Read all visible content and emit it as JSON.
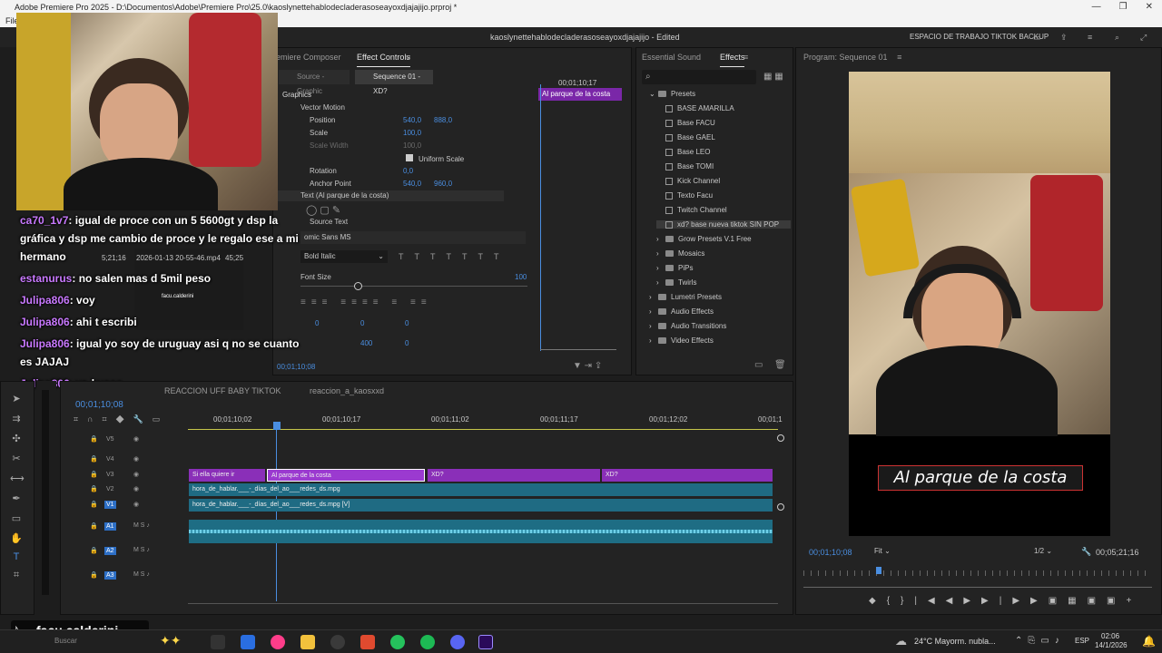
{
  "window": {
    "title": "Adobe Premiere Pro 2025 - D:\\Documentos\\Adobe\\Premiere Pro\\25.0\\kaoslynettehablodecladerasoseayoxdjajajijo.prproj *",
    "menu_first": "File"
  },
  "header": {
    "project_name": "kaoslynettehablodecladerasoseayoxdjajajijo - Edited",
    "workspace": "ESPACIO DE TRABAJO TIKTOK BACKUP"
  },
  "effect_controls": {
    "tab_composer": "remiere Composer",
    "tab_label": "Effect Controls",
    "source_label": "Source - Graphic",
    "sequence_label": "Sequence 01 - XD?",
    "timecode_top": "00;01;10;17",
    "clip_bar_label": "Al parque de la costa",
    "section_graphics": "Graphics",
    "vector_motion": "Vector Motion",
    "position_label": "Position",
    "position_x": "540,0",
    "position_y": "888,0",
    "scale_label": "Scale",
    "scale_value": "100,0",
    "scale_width_label": "Scale Width",
    "scale_width_value": "100,0",
    "uniform_scale": "Uniform Scale",
    "rotation_label": "Rotation",
    "rotation_value": "0,0",
    "anchor_label": "Anchor Point",
    "anchor_x": "540,0",
    "anchor_y": "960,0",
    "text_layer": "Text (Al parque de la costa)",
    "source_text": "Source Text",
    "font_name": "omic Sans MS",
    "font_style": "Bold Italic",
    "font_size_label": "Font Size",
    "font_size_value": "100",
    "kerning_value": "0",
    "tracking_value": "0",
    "leading_value": "0",
    "baseline_value": "0",
    "tsume_value": "400",
    "bottom_timecode": "00;01;10;08"
  },
  "effects": {
    "tab_essential": "Essential Sound",
    "tab_effects": "Effects",
    "tree": [
      {
        "label": "Presets",
        "kind": "folder",
        "level": 1,
        "open": true
      },
      {
        "label": "BASE AMARILLA",
        "kind": "preset",
        "level": 2
      },
      {
        "label": "Base FACU",
        "kind": "preset",
        "level": 2
      },
      {
        "label": "Base GAEL",
        "kind": "preset",
        "level": 2
      },
      {
        "label": "Base LEO",
        "kind": "preset",
        "level": 2
      },
      {
        "label": "Base TOMI",
        "kind": "preset",
        "level": 2
      },
      {
        "label": "Kick Channel",
        "kind": "preset",
        "level": 2
      },
      {
        "label": "Texto Facu",
        "kind": "preset",
        "level": 2
      },
      {
        "label": "Twitch Channel",
        "kind": "preset",
        "level": 2
      },
      {
        "label": "xd? base nueva tiktok SIN POP",
        "kind": "preset",
        "level": 2,
        "selected": true
      },
      {
        "label": "Grow Presets V.1 Free",
        "kind": "folder",
        "level": 2
      },
      {
        "label": "Mosaics",
        "kind": "folder",
        "level": 2
      },
      {
        "label": "PiPs",
        "kind": "folder",
        "level": 2
      },
      {
        "label": "Twirls",
        "kind": "folder",
        "level": 2
      },
      {
        "label": "Lumetri Presets",
        "kind": "folder",
        "level": 1
      },
      {
        "label": "Audio Effects",
        "kind": "folder",
        "level": 1
      },
      {
        "label": "Audio Transitions",
        "kind": "folder",
        "level": 1
      },
      {
        "label": "Video Effects",
        "kind": "folder",
        "level": 1
      }
    ]
  },
  "program": {
    "tab_label": "Program: Sequence 01",
    "caption": "Al parque de la costa",
    "timecode": "00;01;10;08",
    "fit": "Fit",
    "resolution": "1/2",
    "duration": "00;05;21;16"
  },
  "timeline": {
    "tab1": "REACCION UFF BABY TIKTOK",
    "tab2": "reaccion_a_kaosxxd",
    "timecode": "00;01;10;08",
    "ruler": [
      "00;01;10;02",
      "00;01;10;17",
      "00;01;11;02",
      "00;01;11;17",
      "00;01;12;02",
      "00;01;1"
    ],
    "tracks": [
      "V5",
      "V4",
      "V3",
      "V2",
      "V1",
      "A1",
      "A2",
      "A3"
    ],
    "clips": {
      "c1": "Si ella quiere ir",
      "c2": "Al parque de la costa",
      "c3": "XD?",
      "c4": "XD?",
      "v2": "hora_de_hablar.___-_días_del_ao___redes_ds.mpg",
      "v1": "hora_de_hablar.___-_días_del_ao___redes_ds.mpg [V]"
    }
  },
  "overlay": {
    "chat": [
      {
        "user": "ca70_1v7",
        "text": ": igual de proce con un 5 5600gt y dsp la"
      },
      {
        "user": "",
        "text": "gráfica y dsp me cambio de proce y le regalo ese a mi"
      },
      {
        "user": "",
        "text": "hermano"
      },
      {
        "user": "estanurus",
        "text": ": no salen mas d 5mil peso"
      },
      {
        "user": "Julipa806",
        "text": ": voy"
      },
      {
        "user": "Julipa806",
        "text": ": ahi t escribi"
      },
      {
        "user": "Julipa806",
        "text": ": igual yo soy de uruguay asi q no se cuanto"
      },
      {
        "user": "",
        "text": "es JAJAJ"
      },
      {
        "user": "Julipa806",
        "text": ": ya busco"
      }
    ],
    "media_info": "2026-01-13 20-55-46.mp4",
    "media_dur1": "5;21;16",
    "media_dur2": "45;25",
    "media_badge": "facu.calderini",
    "watermark": "facu.calderini"
  },
  "taskbar": {
    "weather": "24°C  Mayorm. nubla...",
    "lang": "ESP",
    "time": "02:06",
    "date": "14/1/2026",
    "search": "Buscar"
  }
}
